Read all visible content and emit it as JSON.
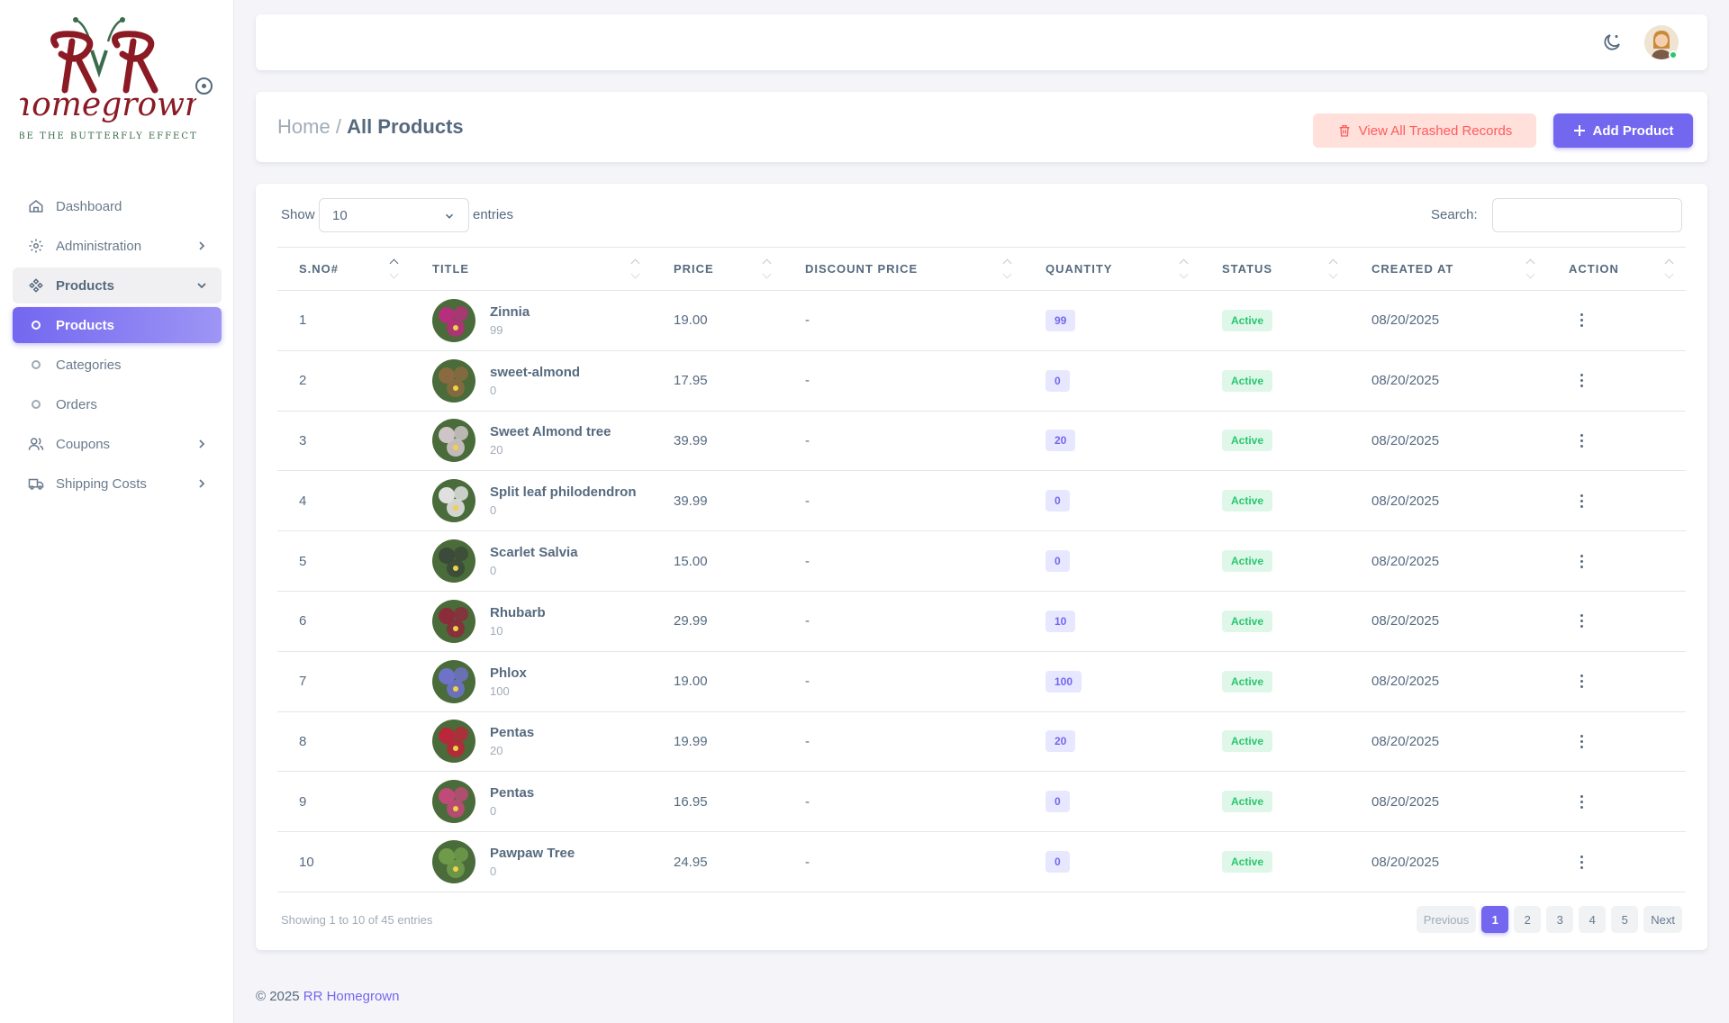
{
  "brand": {
    "logo_word": "homegrown",
    "logo_tagline": "BE THE BUTTERFLY EFFECT"
  },
  "sidebar": {
    "items": [
      {
        "label": "Dashboard",
        "icon": "home-icon"
      },
      {
        "label": "Administration",
        "icon": "gear-icon"
      },
      {
        "label": "Products",
        "icon": "diamonds-icon"
      },
      {
        "label": "Products",
        "icon": "dot-icon"
      },
      {
        "label": "Categories",
        "icon": "dot-icon"
      },
      {
        "label": "Orders",
        "icon": "dot-icon"
      },
      {
        "label": "Coupons",
        "icon": "users-icon"
      },
      {
        "label": "Shipping Costs",
        "icon": "truck-icon"
      }
    ]
  },
  "header": {
    "breadcrumb_home": "Home",
    "breadcrumb_sep": "/",
    "breadcrumb_current": "All Products",
    "trash_button": "View All Trashed Records",
    "add_button": "Add Product"
  },
  "table_controls": {
    "show_label": "Show",
    "page_size": "10",
    "entries_label": "entries",
    "search_label": "Search:"
  },
  "columns": [
    "S.NO#",
    "TITLE",
    "PRICE",
    "DISCOUNT PRICE",
    "QUANTITY",
    "STATUS",
    "CREATED AT",
    "ACTION"
  ],
  "rows": [
    {
      "sno": "1",
      "title": "Zinnia",
      "sub": "99",
      "price": "19.00",
      "discount": "-",
      "qty": "99",
      "status": "Active",
      "created": "08/20/2025"
    },
    {
      "sno": "2",
      "title": "sweet-almond",
      "sub": "0",
      "price": "17.95",
      "discount": "-",
      "qty": "0",
      "status": "Active",
      "created": "08/20/2025"
    },
    {
      "sno": "3",
      "title": "Sweet Almond tree",
      "sub": "20",
      "price": "39.99",
      "discount": "-",
      "qty": "20",
      "status": "Active",
      "created": "08/20/2025"
    },
    {
      "sno": "4",
      "title": "Split leaf philodendron",
      "sub": "0",
      "price": "39.99",
      "discount": "-",
      "qty": "0",
      "status": "Active",
      "created": "08/20/2025"
    },
    {
      "sno": "5",
      "title": "Scarlet Salvia",
      "sub": "0",
      "price": "15.00",
      "discount": "-",
      "qty": "0",
      "status": "Active",
      "created": "08/20/2025"
    },
    {
      "sno": "6",
      "title": "Rhubarb",
      "sub": "10",
      "price": "29.99",
      "discount": "-",
      "qty": "10",
      "status": "Active",
      "created": "08/20/2025"
    },
    {
      "sno": "7",
      "title": "Phlox",
      "sub": "100",
      "price": "19.00",
      "discount": "-",
      "qty": "100",
      "status": "Active",
      "created": "08/20/2025"
    },
    {
      "sno": "8",
      "title": "Pentas",
      "sub": "20",
      "price": "19.99",
      "discount": "-",
      "qty": "20",
      "status": "Active",
      "created": "08/20/2025"
    },
    {
      "sno": "9",
      "title": "Pentas",
      "sub": "0",
      "price": "16.95",
      "discount": "-",
      "qty": "0",
      "status": "Active",
      "created": "08/20/2025"
    },
    {
      "sno": "10",
      "title": "Pawpaw Tree",
      "sub": "0",
      "price": "24.95",
      "discount": "-",
      "qty": "0",
      "status": "Active",
      "created": "08/20/2025"
    }
  ],
  "thumb_colors": [
    "#b5307a",
    "#8a6a3f",
    "#cfc4c8",
    "#e0e0e0",
    "#3b4a3a",
    "#8c2c3b",
    "#6e72c9",
    "#b8283a",
    "#c04a78",
    "#6f9a4a"
  ],
  "pagination": {
    "info": "Showing 1 to 10 of 45 entries",
    "previous": "Previous",
    "pages": [
      "1",
      "2",
      "3",
      "4",
      "5"
    ],
    "next": "Next"
  },
  "footer": {
    "copyright": "© 2025",
    "brand_link": "RR Homegrown"
  },
  "colors": {
    "accent": "#7367f0",
    "success": "#28c76f",
    "danger": "#ff5b5c"
  }
}
